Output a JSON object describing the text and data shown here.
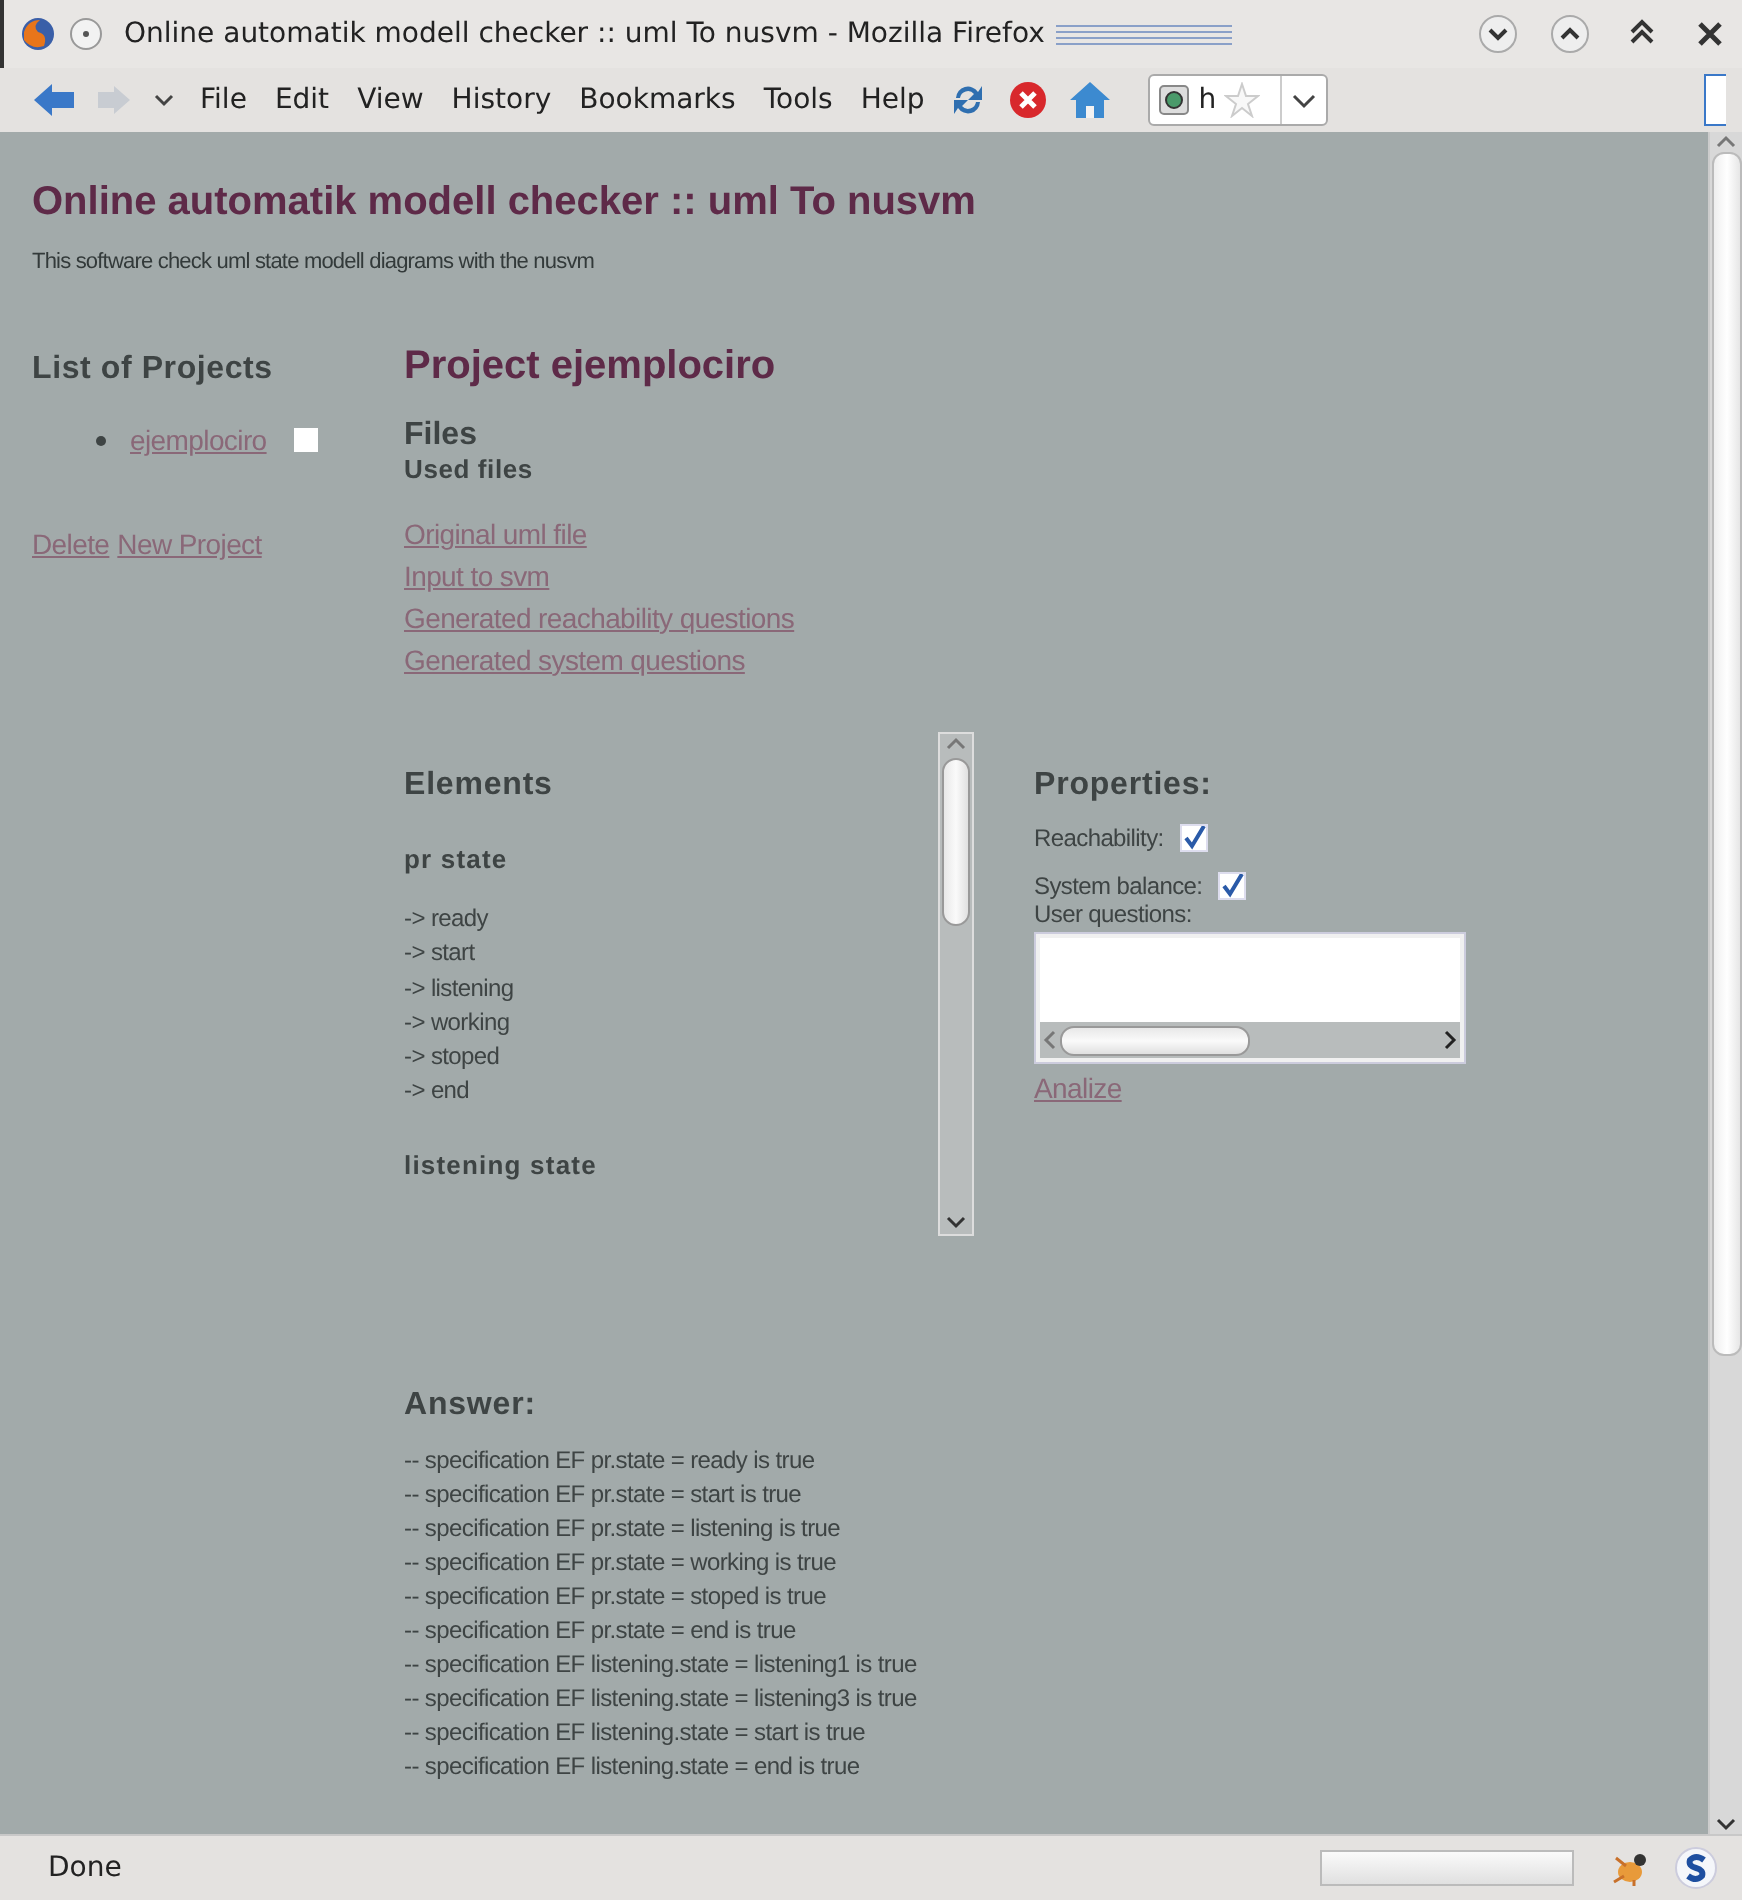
{
  "window": {
    "title": "Online automatik modell checker :: uml To nusvm - Mozilla Firefox"
  },
  "menu": [
    "File",
    "Edit",
    "View",
    "History",
    "Bookmarks",
    "Tools",
    "Help"
  ],
  "address_bar": {
    "value": "h"
  },
  "page": {
    "title": "Online automatik modell checker :: uml To nusvm",
    "subtitle": "This software check uml state modell diagrams with the nusvm",
    "projects_heading": "List of Projects",
    "projects": [
      {
        "name": "ejemplociro",
        "checked": false
      }
    ],
    "project_actions": [
      "Delete",
      "New Project"
    ],
    "project_title": "Project ejemplociro",
    "files_heading": "Files",
    "used_files_heading": "Used files",
    "file_links": [
      "Original uml file",
      "Input to svm",
      "Generated reachability questions",
      "Generated system questions"
    ],
    "elements": {
      "heading": "Elements",
      "groups": [
        {
          "title": "pr state",
          "items": [
            "-> ready",
            "-> start",
            "-> listening",
            "-> working",
            "-> stoped",
            "-> end"
          ]
        },
        {
          "title": "listening state"
        }
      ]
    },
    "properties": {
      "heading": "Properties:",
      "options": [
        {
          "label": "Reachability:",
          "checked": true
        },
        {
          "label": "System balance:",
          "checked": true
        }
      ],
      "questions_label": "User questions:",
      "analize": "Analize"
    },
    "answer": {
      "heading": "Answer:",
      "lines": [
        "-- specification EF pr.state = ready is true",
        "-- specification EF pr.state = start is true",
        "-- specification EF pr.state = listening is true",
        "-- specification EF pr.state = working is true",
        "-- specification EF pr.state = stoped is true",
        "-- specification EF pr.state = end is true",
        "-- specification EF listening.state = listening1 is true",
        "-- specification EF listening.state = listening3 is true",
        "-- specification EF listening.state = start is true",
        "-- specification EF listening.state = end is true"
      ]
    }
  },
  "status_bar": {
    "text": "Done",
    "progress": {
      "level": 0
    }
  }
}
